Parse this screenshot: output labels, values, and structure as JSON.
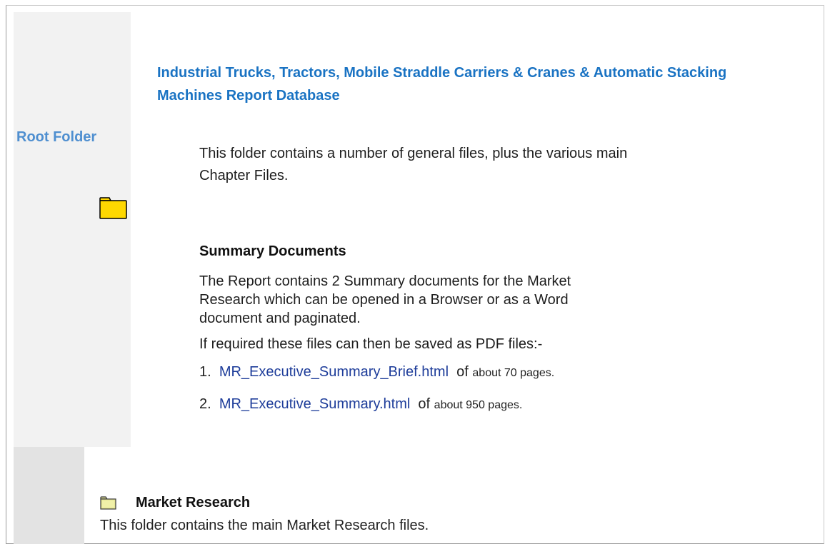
{
  "sidebar": {
    "root_label": "Root Folder",
    "folder_icon": "folder-icon"
  },
  "main": {
    "title": "Industrial Trucks, Tractors, Mobile Straddle Carriers & Cranes & Automatic Stacking Machines Report Database",
    "intro": "This folder contains a number of general files, plus the various main Chapter Files.",
    "summary_heading": "Summary Documents",
    "summary_text": "The Report contains 2 Summary documents for the Market Research which can be opened in a Browser or as a Word document and paginated.",
    "pdf_note": "If required these files can then be saved as PDF files:-",
    "files": [
      {
        "num": "1.",
        "link": "MR_Executive_Summary_Brief.html",
        "of": "of",
        "pages": "about 70 pages."
      },
      {
        "num": "2.",
        "link": "MR_Executive_Summary.html",
        "of": "of",
        "pages": "about 950 pages."
      }
    ]
  },
  "market_research": {
    "title": "Market Research",
    "description": "This folder contains the main Market Research files.",
    "icon": "folder-icon"
  },
  "colors": {
    "title": "#1a73c3",
    "root_label": "#4f8fd0",
    "link": "#1e3d9a",
    "folder_fill": "#ffd800"
  }
}
